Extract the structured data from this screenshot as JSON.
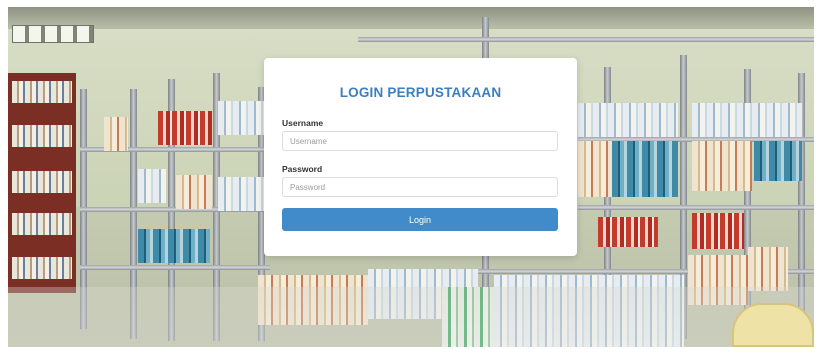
{
  "login": {
    "title": "LOGIN PERPUSTAKAAN",
    "username_label": "Username",
    "username_placeholder": "Username",
    "username_value": "",
    "password_label": "Password",
    "password_placeholder": "Password",
    "password_value": "",
    "button_label": "Login"
  },
  "colors": {
    "title": "#3a7fc0",
    "button_bg": "#428bca",
    "button_text": "#ffffff",
    "card_bg": "#ffffff"
  }
}
